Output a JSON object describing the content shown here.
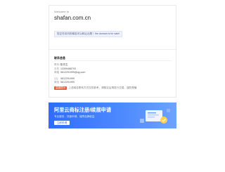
{
  "header": {
    "welcome": "Welcome to",
    "domain": "shafan.com.cn",
    "description": "您正在访问的域名可以转让出售！the domain is for sale!"
  },
  "info": {
    "title": "联系信息",
    "rows": [
      {
        "label": "联系人",
        "value": "张先生"
      },
      {
        "label": "手机",
        "value": "13399488793"
      },
      {
        "label": "邮箱",
        "value": "5612291999@qq.com"
      },
      {
        "label": "QQ",
        "value": "5612291999"
      },
      {
        "label": "微信",
        "value": "5612291999"
      }
    ],
    "tip_badge": "温馨提示",
    "tip": "上述域名联系方式仅供参考，请核实后再进行交易，谨防受骗"
  },
  "banner": {
    "title": "阿里云商标注册/续展申请",
    "subtitle": "专业服务，快速申请，保障品牌权益",
    "button": "立即申请"
  }
}
